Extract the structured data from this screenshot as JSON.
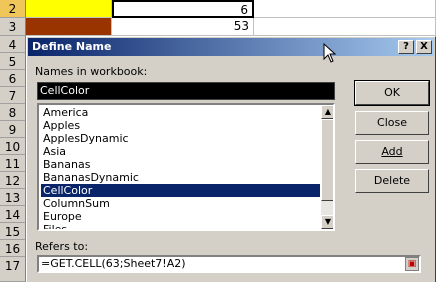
{
  "sheet": {
    "row_headers": [
      "2",
      "3",
      "4",
      "5",
      "6",
      "7",
      "8",
      "9",
      "10",
      "11",
      "12",
      "13",
      "14",
      "15",
      "16",
      "17"
    ],
    "values": {
      "r2": "6",
      "r3": "53"
    },
    "colors": {
      "yellow": "#ffff00",
      "brown": "#993300"
    }
  },
  "dialog": {
    "title": "Define Name",
    "help_btn": "?",
    "close_btn": "X",
    "names_label": "Names in workbook:",
    "name_value": "CellColor",
    "names": [
      "America",
      "Apples",
      "ApplesDynamic",
      "Asia",
      "Bananas",
      "BananasDynamic",
      "CellColor",
      "ColumnSum",
      "Europe",
      "Files"
    ],
    "selected_name": "CellColor",
    "buttons": {
      "ok": "OK",
      "close": "Close",
      "add": "Add",
      "delete": "Delete"
    },
    "refers_label": "Refers to:",
    "refers_value": "=GET.CELL(63;Sheet7!A2)"
  },
  "icons": [
    "chevron-up-icon",
    "chevron-down-icon",
    "collapse-dialog-icon",
    "mouse-cursor-icon"
  ]
}
